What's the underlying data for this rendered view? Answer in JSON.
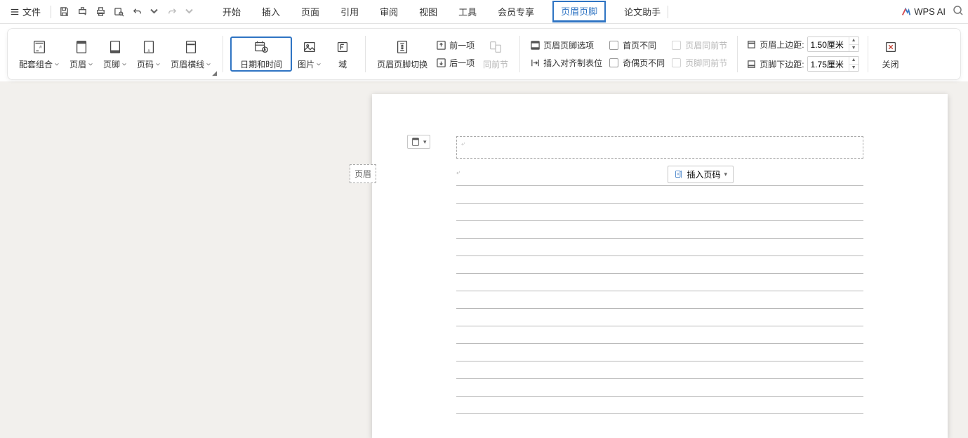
{
  "menubar": {
    "file_label": "文件",
    "tabs": [
      "开始",
      "插入",
      "页面",
      "引用",
      "审阅",
      "视图",
      "工具",
      "会员专享",
      "页眉页脚",
      "论文助手"
    ],
    "active_tab_index": 8,
    "wps_ai_label": "WPS AI"
  },
  "ribbon": {
    "group1": {
      "combo": "配套组合",
      "header": "页眉",
      "footer": "页脚",
      "pagenum": "页码",
      "hr": "页眉横线"
    },
    "group2": {
      "datetime": "日期和时间",
      "picture": "图片",
      "field": "域"
    },
    "group3": {
      "switch": "页眉页脚切换",
      "prev": "前一项",
      "next": "后一项",
      "same": "同前节"
    },
    "group4": {
      "options": "页眉页脚选项",
      "align": "插入对齐制表位",
      "diff_first": "首页不同",
      "diff_oddeven": "奇偶页不同",
      "header_same": "页眉同前节",
      "footer_same": "页脚同前节"
    },
    "group5": {
      "header_margin_lbl": "页眉上边距:",
      "footer_margin_lbl": "页脚下边距:",
      "header_margin_val": "1.50厘米",
      "footer_margin_val": "1.75厘米"
    },
    "close": "关闭"
  },
  "doc": {
    "header_tag": "页眉",
    "insert_pagenum": "插入页码"
  }
}
